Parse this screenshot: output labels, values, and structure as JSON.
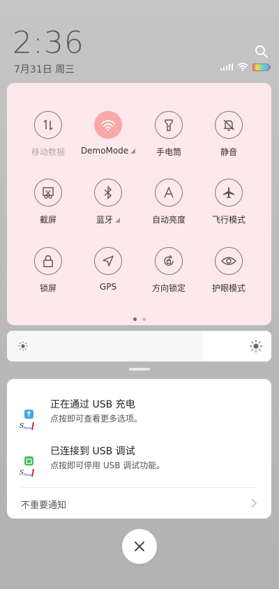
{
  "status": {
    "time": "2:36",
    "date": "7月31日 周三"
  },
  "tiles": [
    {
      "label": "移动数据",
      "icon": "mobile-data-icon",
      "active": false,
      "dim": true
    },
    {
      "label": "DemoMode",
      "icon": "wifi-icon",
      "active": true,
      "expand": true
    },
    {
      "label": "手电筒",
      "icon": "flashlight-icon",
      "active": false
    },
    {
      "label": "静音",
      "icon": "mute-icon",
      "active": false
    },
    {
      "label": "截屏",
      "icon": "screenshot-icon",
      "active": false
    },
    {
      "label": "蓝牙",
      "icon": "bluetooth-icon",
      "active": false,
      "expand": true
    },
    {
      "label": "自动亮度",
      "icon": "auto-brightness-icon",
      "active": false
    },
    {
      "label": "飞行模式",
      "icon": "airplane-icon",
      "active": false
    },
    {
      "label": "锁屏",
      "icon": "lock-icon",
      "active": false
    },
    {
      "label": "GPS",
      "icon": "gps-icon",
      "active": false
    },
    {
      "label": "方向锁定",
      "icon": "rotation-lock-icon",
      "active": false
    },
    {
      "label": "护眼模式",
      "icon": "eye-icon",
      "active": false
    }
  ],
  "brightness": {
    "level": 0.74
  },
  "notifications": [
    {
      "title": "正在通过 USB 充电",
      "subtitle": "点按即可查看更多选项。",
      "icon": "usb-app-icon"
    },
    {
      "title": "已连接到 USB 调试",
      "subtitle": "点按即可停用 USB 调试功能。",
      "icon": "usb-debug-app-icon"
    }
  ],
  "footer": {
    "more_label": "不重要通知"
  },
  "colors": {
    "panel": "#fde8ec",
    "active_tile": "#f9a8a8"
  }
}
